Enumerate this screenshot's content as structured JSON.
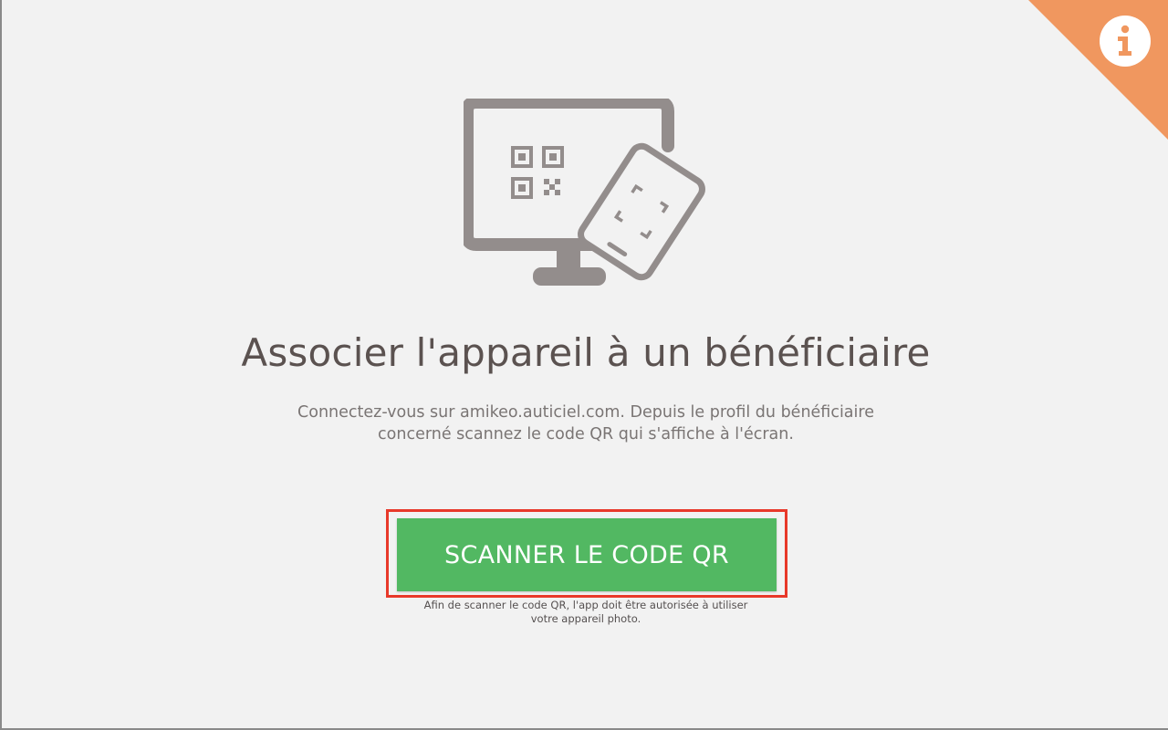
{
  "header": {
    "info_icon": "info-icon",
    "accent_color": "#f0975f"
  },
  "illustration": {
    "icon": "monitor-qr-tablet-icon",
    "color": "#938d8c"
  },
  "main": {
    "title": "Associer l'appareil à un bénéficiaire",
    "description_line1": "Connectez-vous sur amikeo.auticiel.com. Depuis le profil du bénéficiaire",
    "description_line2": "concerné scannez le code QR qui s'affiche à l'écran."
  },
  "scan": {
    "button_label": "SCANNER LE CODE QR",
    "button_color": "#52b862",
    "highlight_color": "#e8392a",
    "note_line1": "Afin de scanner le code QR, l'app doit être autorisée à utiliser",
    "note_line2": "votre appareil photo."
  }
}
